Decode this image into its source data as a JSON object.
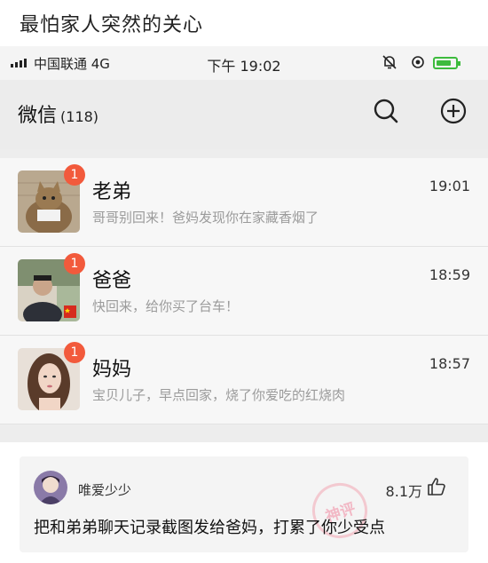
{
  "post": {
    "title": "最怕家人突然的关心"
  },
  "status_bar": {
    "carrier": "中国联通 4G",
    "time": "下午 19:02"
  },
  "header": {
    "title": "微信",
    "count": "(118)"
  },
  "chats": [
    {
      "name": "老弟",
      "time": "19:01",
      "badge": "1",
      "preview": "哥哥别回来！爸妈发现你在家藏香烟了"
    },
    {
      "name": "爸爸",
      "time": "18:59",
      "badge": "1",
      "preview": "快回来，给你买了台车！"
    },
    {
      "name": "妈妈",
      "time": "18:57",
      "badge": "1",
      "preview": "宝贝儿子，早点回家，烧了你爱吃的红烧肉"
    }
  ],
  "comment": {
    "user": "唯爱少少",
    "likes": "8.1万",
    "text": "把和弟弟聊天记录截图发给爸妈，打累了你少受点",
    "stamp": "神评"
  },
  "colors": {
    "badge": "#f25a3c",
    "battery": "#3dbb3d",
    "preview_text": "#9b9b9b"
  }
}
